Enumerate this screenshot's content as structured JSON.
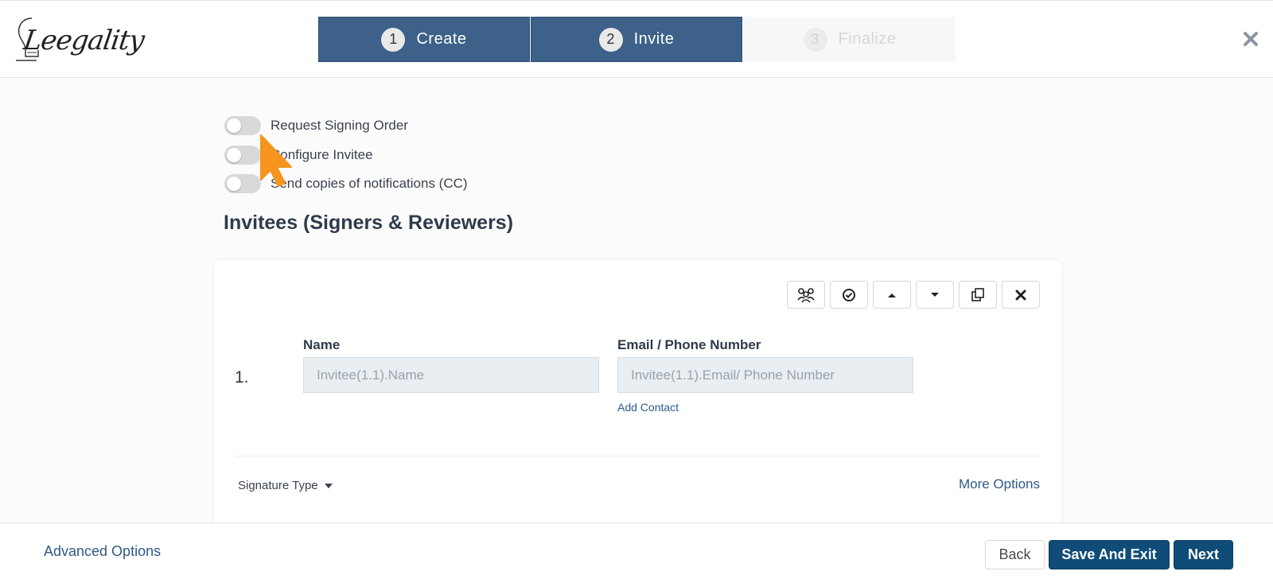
{
  "brand": {
    "logo_text": "Leegality"
  },
  "steps": [
    {
      "number": "1",
      "label": "Create",
      "state": "active"
    },
    {
      "number": "2",
      "label": "Invite",
      "state": "active"
    },
    {
      "number": "3",
      "label": "Finalize",
      "state": "inactive"
    }
  ],
  "toggles": [
    {
      "label": "Request Signing Order",
      "on": false
    },
    {
      "label": "Configure Invitee",
      "on": false
    },
    {
      "label": "Send copies of notifications (CC)",
      "on": false
    }
  ],
  "section_title": "Invitees (Signers & Reviewers)",
  "invitee": {
    "index": "1.",
    "name_label": "Name",
    "name_placeholder": "Invitee(1.1).Name",
    "email_label": "Email / Phone Number",
    "email_placeholder": "Invitee(1.1).Email/ Phone Number",
    "add_contact": "Add Contact",
    "signature_type": "Signature Type",
    "more_options": "More Options"
  },
  "toolbar_icons": [
    "group-icon",
    "check-circle-icon",
    "move-up-icon",
    "move-down-icon",
    "copy-icon",
    "remove-icon"
  ],
  "footer": {
    "advanced_options": "Advanced Options",
    "back": "Back",
    "save_and_exit": "Save And Exit",
    "next": "Next"
  },
  "colors": {
    "step_active": "#3d6189",
    "primary_button": "#0f4c78",
    "link": "#2e5a87",
    "cursor": "#f7941d"
  }
}
